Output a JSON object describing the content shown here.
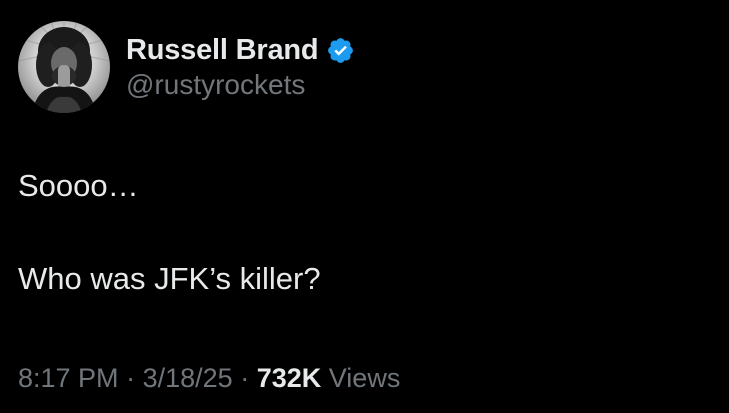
{
  "colors": {
    "background": "#000000",
    "primary_text": "#e7e9ea",
    "secondary_text": "#71767b",
    "verified_badge": "#1d9bf0"
  },
  "author": {
    "display_name": "Russell Brand",
    "handle": "@rustyrockets",
    "avatar_icon": "avatar-image",
    "verified_icon": "verified-badge-icon"
  },
  "tweet": {
    "lines": [
      "Soooo…",
      "Who was JFK’s killer?"
    ]
  },
  "meta": {
    "time": "8:17 PM",
    "separator": "·",
    "date": "3/18/25",
    "views_count": "732K",
    "views_label": "Views"
  }
}
